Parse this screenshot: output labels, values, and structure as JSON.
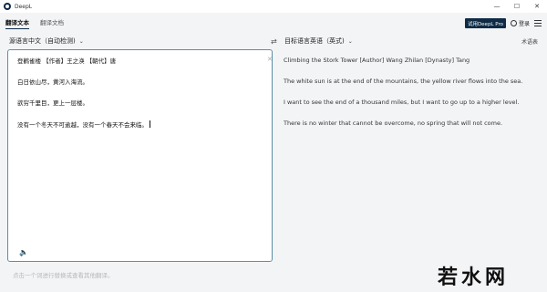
{
  "window": {
    "title": "DeepL",
    "min": "—",
    "max": "☐",
    "close": "✕"
  },
  "tabs": [
    {
      "label": "翻译文本"
    },
    {
      "label": "翻译文档"
    }
  ],
  "header": {
    "pro_label": "试用DeepL Pro",
    "login_label": "登录"
  },
  "languages": {
    "source": "源语言中文（自动检测)",
    "target": "目标语言英语（英式)",
    "glossary": "术语表"
  },
  "source_text": {
    "lines": [
      "登鹳雀楼 【作者】王之涣 【朝代】唐",
      "白日依山尽，黄河入海流。",
      "欲穷千里目，更上一层楼。",
      "没有一个冬天不可逾越，没有一个春天不会来临。"
    ]
  },
  "target_text": {
    "lines": [
      "Climbing the Stork Tower [Author] Wang Zhilan [Dynasty] Tang",
      "The white sun is at the end of the mountains, the yellow river flows into the sea.",
      "I want to see the end of a thousand miles, but I want to go up to a higher level.",
      "There is no winter that cannot be overcome, no spring that will not come."
    ]
  },
  "footer": {
    "hint": "点击一个词进行替换或查看其他翻译。"
  },
  "watermark": "若水网"
}
